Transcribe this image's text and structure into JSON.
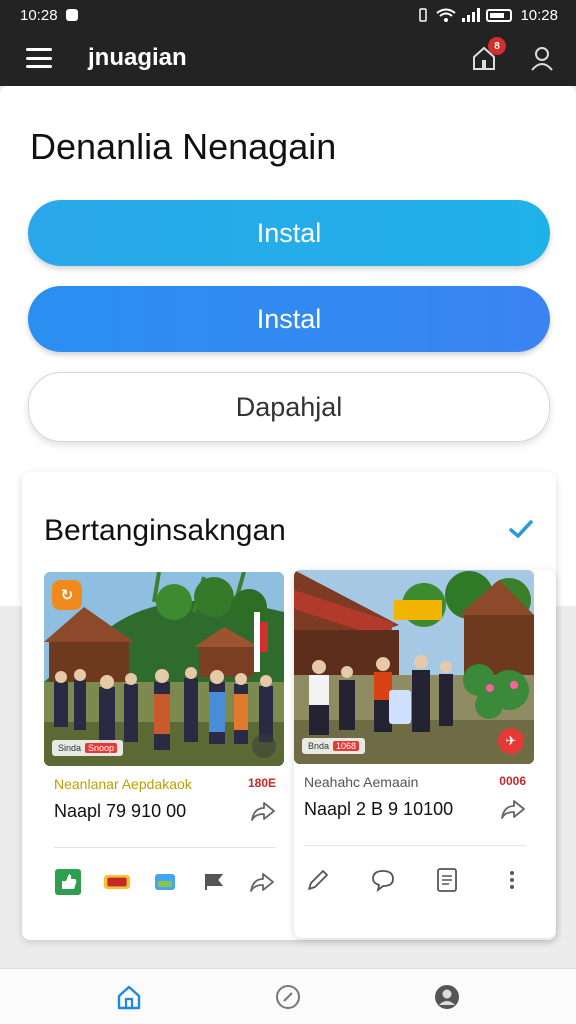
{
  "status_bar": {
    "time_left": "10:28",
    "time_right": "10:28"
  },
  "app_bar": {
    "title": "jnuagian",
    "notification_count": "8"
  },
  "page": {
    "title": "Denanlia Nenagain"
  },
  "buttons": {
    "primary_1": "Instal",
    "primary_2": "Instal",
    "secondary": "Dapahjal"
  },
  "section": {
    "title": "Bertanginsakngan"
  },
  "posts": [
    {
      "name": "Neanlanar Aepdakaok",
      "count": "180E",
      "price": "Naapl 79 910 00",
      "sticker_label": "Sinda",
      "sticker_tag": "Snoop"
    },
    {
      "name": "Neahahc Aemaain",
      "count": "0006",
      "price": "Naapl 2 B 9 10100",
      "sticker_label": "Bnda",
      "sticker_tag": "1068"
    }
  ],
  "post1_actions": [
    "share-icon",
    "badge-icon",
    "tag-icon",
    "flag-icon",
    "share-icon"
  ],
  "post2_actions": [
    "edit-icon",
    "comment-icon",
    "document-icon",
    "more-vertical-icon"
  ],
  "bottom_nav": [
    "home-icon",
    "explore-icon",
    "profile-icon"
  ],
  "colors": {
    "accent": "#1e88e5",
    "button_1": "#1fb2e8",
    "button_2": "#3a84f2",
    "appbar": "#232323",
    "check": "#2a9ad6",
    "badge": "#d32f2f"
  }
}
